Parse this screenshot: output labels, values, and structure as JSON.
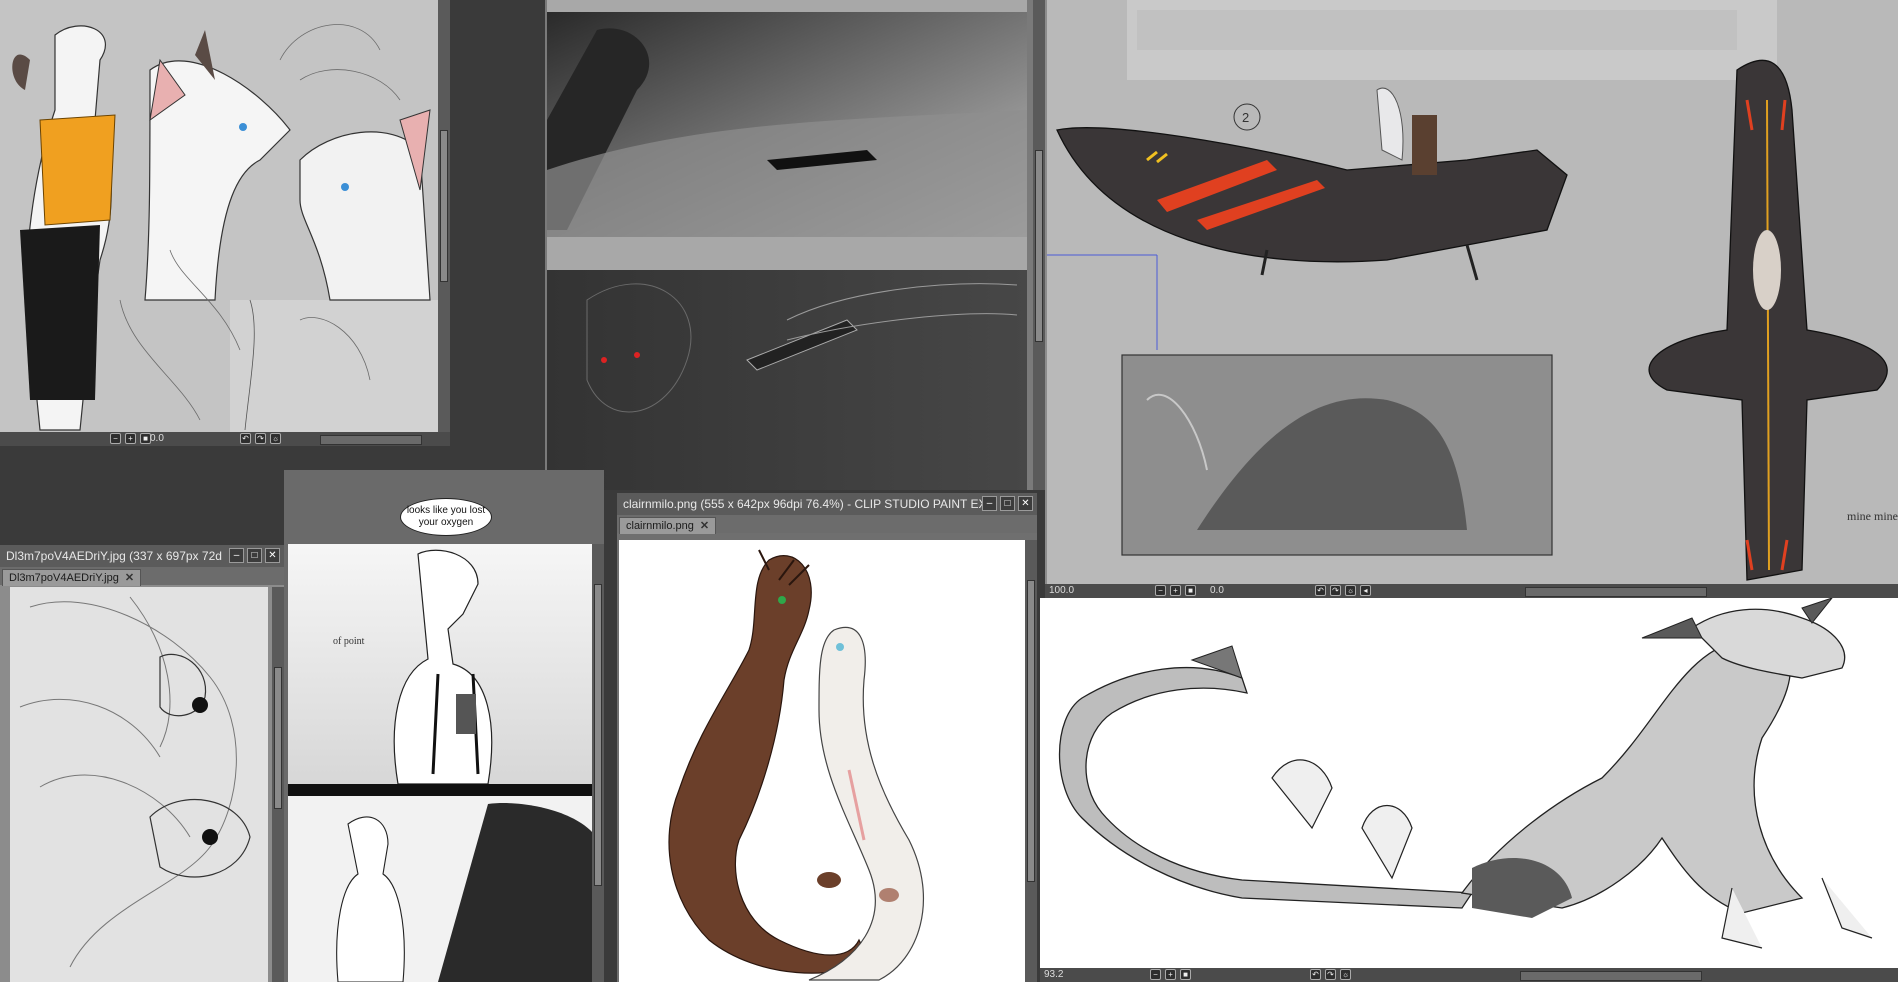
{
  "app": {
    "name": "CLIP STUDIO PAINT EX"
  },
  "windows": {
    "top_left": {
      "zoom": "",
      "angle": "0.0"
    },
    "top_center": {
      "zoom": "",
      "angle": ""
    },
    "top_right": {
      "zoom": "100.0",
      "angle": "0.0"
    },
    "left_small": {
      "title": "Dl3m7poV4AEDriY.jpg (337 x 697px 72d",
      "tab": "Dl3m7poV4AEDriY.jpg"
    },
    "center": {
      "title": "clairnmilo.png (555 x 642px 96dpi 76.4%)  - CLIP STUDIO PAINT EX",
      "tab": "clairnmilo.png"
    },
    "bottom_right": {
      "zoom": "93.2"
    }
  },
  "canvas_text": {
    "speech_bubble": "looks like you lost your oxygen",
    "sketch_label": "of point",
    "circle_number": "2",
    "margin_notes": "mine mine mine"
  },
  "icons": [
    "minimize-icon",
    "maximize-icon",
    "close-icon",
    "zoom-out-icon",
    "zoom-in-icon",
    "fit-icon",
    "rotate-left-icon",
    "rotate-right-icon",
    "reset-icon",
    "scroll-left-icon",
    "scroll-right-icon"
  ],
  "colors": {
    "workspace": "#3a3a3a",
    "titlebar": "#5b5b5b",
    "panel": "#8c8c8c",
    "accent_red": "#e04020",
    "accent_orange": "#f0a020"
  }
}
